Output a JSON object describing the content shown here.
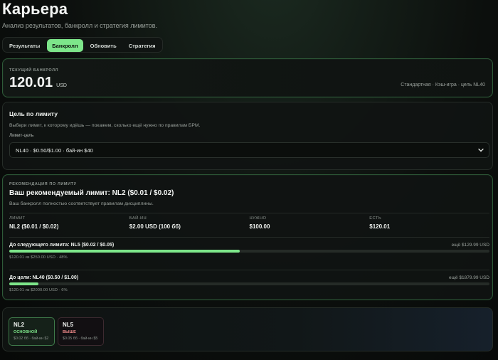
{
  "header": {
    "title": "Карьера",
    "subtitle": "Анализ результатов, банкролл и стратегия лимитов."
  },
  "tabs": [
    {
      "label": "Результаты",
      "active": false
    },
    {
      "label": "Банкролл",
      "active": true
    },
    {
      "label": "Обновить",
      "active": false
    },
    {
      "label": "Стратегия",
      "active": false
    }
  ],
  "bankroll": {
    "label": "ТЕКУЩИЙ БАНКРОЛЛ",
    "amount": "120.01",
    "currency": "USD",
    "meta": "Стандартная · Кэш-игра · цель NL40"
  },
  "target": {
    "heading": "Цель по лимиту",
    "description": "Выбери лимит, к которому идёшь — покажем, сколько ещё нужно по правилам БРМ.",
    "field_label": "Лимит-цель",
    "selected": "NL40 · $0.50/$1.00 · бай-ин $40"
  },
  "recommendation": {
    "label": "РЕКОМЕНДАЦИЯ ПО ЛИМИТУ",
    "title": "Ваш рекомендуемый лимит: NL2 ($0.01 / $0.02)",
    "description": "Ваш банкролл полностью соответствует правилам дисциплины.",
    "stats": [
      {
        "key": "ЛИМИТ",
        "value": "NL2 ($0.01 / $0.02)"
      },
      {
        "key": "БАЙ-ИН",
        "value": "$2.00 USD (100 бб)"
      },
      {
        "key": "НУЖНО",
        "value": "$100.00"
      },
      {
        "key": "ЕСТЬ",
        "value": "$120.01"
      }
    ],
    "progress": [
      {
        "title": "До следующего лимита: NL5 ($0.02 / $0.05)",
        "remaining": "ещё $129.99 USD",
        "sub": "$120.01 из $250.00 USD · 48%",
        "percent": 48
      },
      {
        "title": "До цели: NL40 ($0.50 / $1.00)",
        "remaining": "ещё $1879.99 USD",
        "sub": "$120.01 из $2000.00 USD · 6%",
        "percent": 6
      }
    ]
  },
  "limits": [
    {
      "name": "NL2",
      "status": "ОСНОВНОЙ",
      "meta": "$0.02 бб · бай-ин $2"
    },
    {
      "name": "NL5",
      "status": "ВЫШЕ",
      "meta": "$0.05 бб · бай-ин $5"
    }
  ],
  "colors": {
    "accent": "#7de68a",
    "warn": "#f08a8a",
    "background": "#0c0f0d"
  }
}
